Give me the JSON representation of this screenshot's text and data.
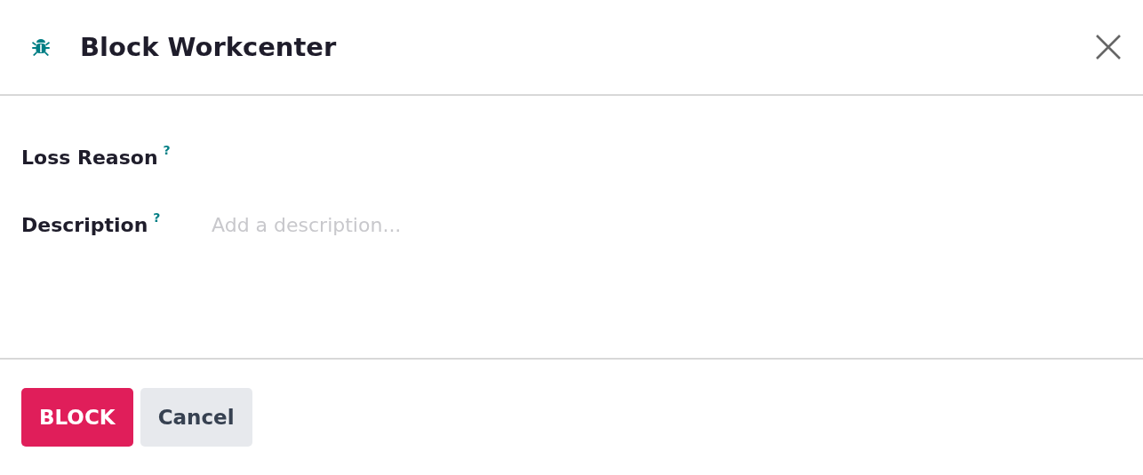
{
  "dialog": {
    "title": "Block Workcenter"
  },
  "fields": [
    {
      "label": "Loss Reason",
      "help": "?"
    },
    {
      "label": "Description",
      "help": "?",
      "placeholder": "Add a description..."
    }
  ],
  "buttons": [
    {
      "label": "BLOCK",
      "kind": "primary"
    },
    {
      "label": "Cancel",
      "kind": "secondary"
    }
  ]
}
